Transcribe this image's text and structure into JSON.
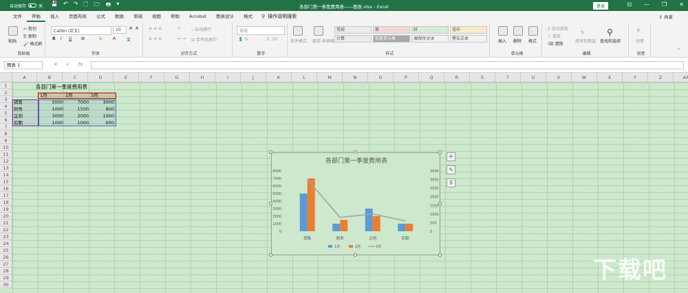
{
  "titlebar": {
    "autosave": "自动保存",
    "autosave_state": "关",
    "title": "各部门第一季度费用表——图表.xlsx - Excel",
    "login": "登录",
    "minimize": "—",
    "restore": "❐",
    "close": "✕"
  },
  "tabs": [
    "文件",
    "开始",
    "插入",
    "页面布局",
    "公式",
    "数据",
    "审阅",
    "视图",
    "帮助",
    "Acrobat",
    "图表设计",
    "格式"
  ],
  "active_tab": "开始",
  "tell_me": "操作说明搜索",
  "share_label": "共享",
  "ribbon": {
    "clipboard": {
      "paste": "粘贴",
      "cut": "剪切",
      "copy": "复制",
      "format_painter": "格式刷",
      "label": "剪贴板"
    },
    "font": {
      "name": "Calibri (正文)",
      "size": "10",
      "bold": "B",
      "italic": "I",
      "underline": "U",
      "label": "字体"
    },
    "alignment": {
      "wrap": "自动换行",
      "merge": "合并后居中",
      "label": "对齐方式"
    },
    "number": {
      "format": "常规",
      "label": "数字"
    },
    "styles": {
      "conditional": "条件格式",
      "table": "套用\n表格格式",
      "cells": [
        "常规",
        "差",
        "好",
        "适中",
        "计算",
        "检查单元格",
        "解释性文本",
        "警告文本"
      ],
      "label": "样式"
    },
    "cells": {
      "insert": "插入",
      "delete": "删除",
      "format": "格式",
      "label": "单元格"
    },
    "editing": {
      "autosum": "自动求和",
      "fill": "填充",
      "clear": "清除",
      "sort": "排序和筛选",
      "find": "查找和选择",
      "label": "编辑"
    },
    "ideas": {
      "label": "创意",
      "btn": "创意"
    }
  },
  "formula_bar": {
    "name_box": "图表 1",
    "cancel": "✕",
    "enter": "✓",
    "fx": "fx",
    "value": ""
  },
  "columns": [
    "A",
    "B",
    "C",
    "D",
    "E",
    "F",
    "G",
    "H",
    "I",
    "J",
    "K",
    "L",
    "M",
    "N",
    "O",
    "P",
    "Q",
    "R",
    "S",
    "T",
    "U",
    "V",
    "W",
    "X",
    "Y",
    "Z",
    "AA"
  ],
  "rows": [
    "1",
    "2",
    "3",
    "4",
    "5",
    "6",
    "7",
    "8",
    "9",
    "10",
    "11",
    "12",
    "13",
    "14",
    "15",
    "16",
    "17",
    "18",
    "19",
    "20",
    "21",
    "22",
    "23",
    "24",
    "25",
    "26",
    "27",
    "28",
    "29",
    "30"
  ],
  "table": {
    "title": "各部门第一季度费用表",
    "headers": [
      "1月",
      "2月",
      "3月"
    ],
    "rows": [
      {
        "dept": "销售",
        "values": [
          "5000",
          "7000",
          "3000"
        ]
      },
      {
        "dept": "财务",
        "values": [
          "1000",
          "1500",
          "800"
        ]
      },
      {
        "dept": "企划",
        "values": [
          "3000",
          "2000",
          "1000"
        ]
      },
      {
        "dept": "后勤",
        "values": [
          "1000",
          "1000",
          "600"
        ]
      }
    ]
  },
  "chart_data": {
    "type": "bar",
    "title": "各部门第一季度费用表",
    "categories": [
      "销售",
      "财务",
      "企划",
      "后勤"
    ],
    "series": [
      {
        "name": "1月",
        "type": "bar",
        "axis": "left",
        "values": [
          5000,
          1000,
          3000,
          1000
        ],
        "color": "#5b9bd5"
      },
      {
        "name": "2月",
        "type": "bar",
        "axis": "left",
        "values": [
          7000,
          1500,
          2000,
          1000
        ],
        "color": "#ed7d31"
      },
      {
        "name": "3月",
        "type": "line",
        "axis": "right",
        "values": [
          3000,
          800,
          1000,
          600
        ],
        "color": "#a5a5a5"
      }
    ],
    "ylim": [
      0,
      8000
    ],
    "yticks": [
      "0",
      "1000",
      "2000",
      "3000",
      "4000",
      "5000",
      "6000",
      "7000",
      "8000"
    ],
    "y2lim": [
      0,
      3500
    ],
    "y2ticks": [
      "0",
      "500",
      "1000",
      "1500",
      "2000",
      "2500",
      "3000",
      "3500"
    ],
    "legend": "bottom"
  },
  "chart_buttons": {
    "elements": "+",
    "styles": "✎",
    "filter": "⊽"
  }
}
